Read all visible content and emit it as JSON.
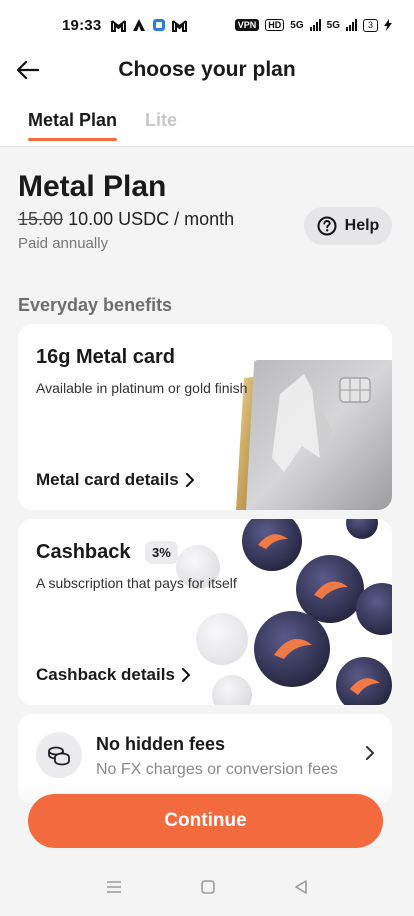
{
  "status_bar": {
    "time": "19:33",
    "vpn": "VPN",
    "hd": "HD",
    "net1": "5G",
    "net2": "5G",
    "battery": "3"
  },
  "header": {
    "title": "Choose your plan",
    "tabs": [
      {
        "label": "Metal Plan",
        "active": true
      },
      {
        "label": "Lite",
        "active": false
      }
    ]
  },
  "plan": {
    "name": "Metal Plan",
    "old_price": "15.00",
    "price": "10.00 USDC / month",
    "billing": "Paid annually",
    "help_label": "Help"
  },
  "section": {
    "label": "Everyday benefits"
  },
  "benefits": [
    {
      "title": "16g Metal card",
      "subtitle": "Available in platinum or gold finish",
      "link": "Metal card details"
    },
    {
      "title": "Cashback",
      "badge": "3%",
      "subtitle": "A subscription that pays for itself",
      "link": "Cashback details"
    },
    {
      "title": "No hidden fees",
      "subtitle": "No FX charges or conversion fees"
    }
  ],
  "cta": {
    "label": "Continue"
  },
  "colors": {
    "accent": "#f26a3d",
    "background": "#f4f4f5"
  }
}
